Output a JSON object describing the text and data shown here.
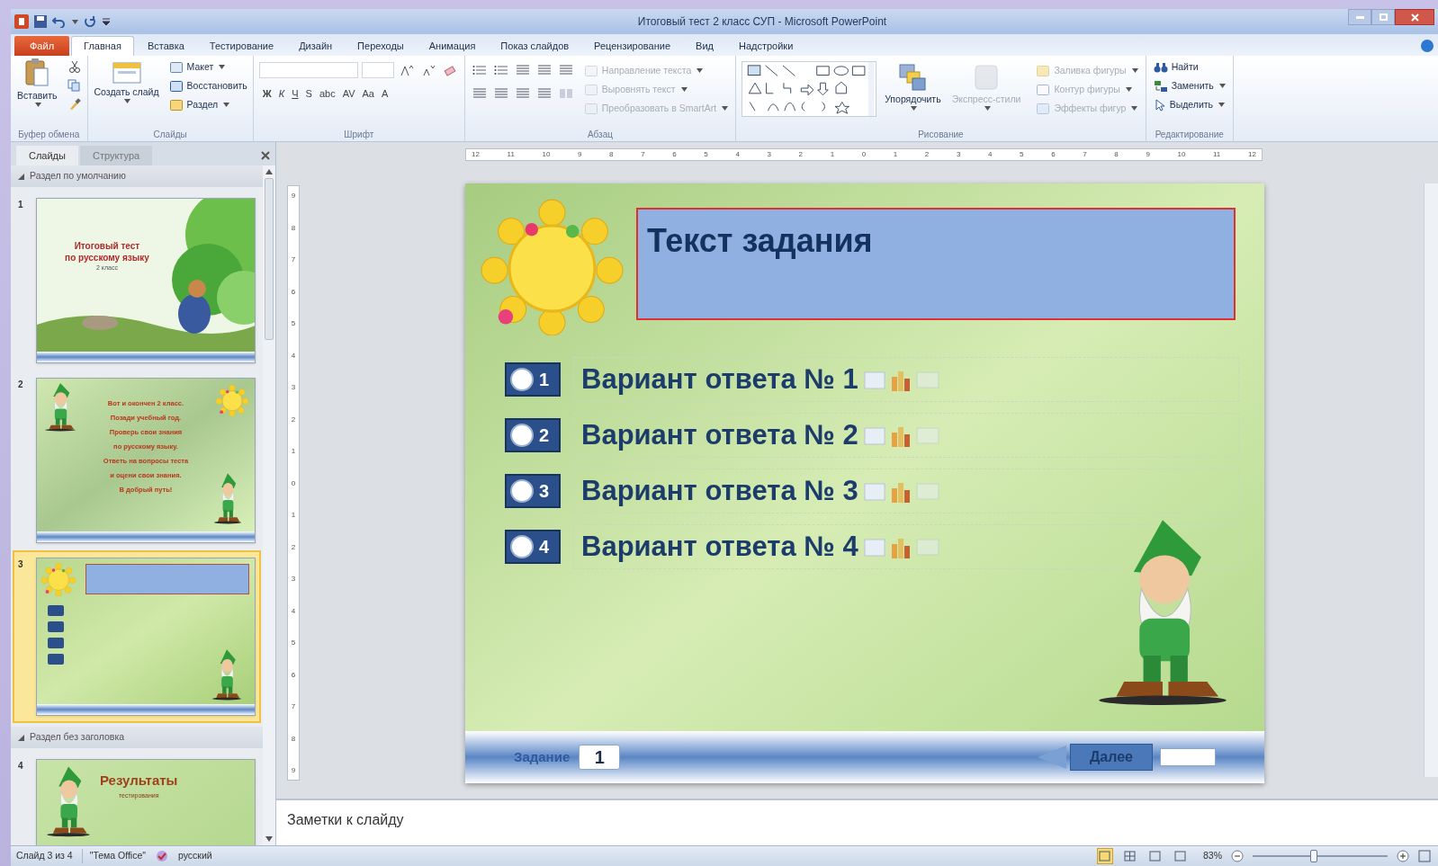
{
  "window": {
    "title": "Итоговый тест 2 класс СУП - Microsoft PowerPoint"
  },
  "file_tab": "Файл",
  "tabs": [
    {
      "label": "Главная",
      "selected": true
    },
    {
      "label": "Вставка",
      "selected": false
    },
    {
      "label": "Тестирование",
      "selected": false
    },
    {
      "label": "Дизайн",
      "selected": false
    },
    {
      "label": "Переходы",
      "selected": false
    },
    {
      "label": "Анимация",
      "selected": false
    },
    {
      "label": "Показ слайдов",
      "selected": false
    },
    {
      "label": "Рецензирование",
      "selected": false
    },
    {
      "label": "Вид",
      "selected": false
    },
    {
      "label": "Надстройки",
      "selected": false
    }
  ],
  "ribbon_groups": [
    {
      "kind": "clipboard",
      "label": "Буфер обмена",
      "items": [
        {
          "label": "Вставить",
          "disabled": false
        }
      ]
    },
    {
      "kind": "slides",
      "label": "Слайды",
      "items": [
        {
          "label": "Создать слайд",
          "disabled": false
        },
        {
          "label": "Макет",
          "disabled": false
        },
        {
          "label": "Восстановить",
          "disabled": false
        },
        {
          "label": "Раздел",
          "disabled": false
        }
      ]
    },
    {
      "kind": "font",
      "label": "Шрифт",
      "glyphs": [
        "Ж",
        "К",
        "Ч",
        "S",
        "abc",
        "AV",
        "Aa",
        "A"
      ]
    },
    {
      "kind": "paragraph",
      "label": "Абзац",
      "items": [
        {
          "label": "Направление текста",
          "disabled": true
        },
        {
          "label": "Выровнять текст",
          "disabled": true
        },
        {
          "label": "Преобразовать в SmartArt",
          "disabled": true
        }
      ]
    },
    {
      "kind": "drawing",
      "label": "Рисование",
      "items": [
        {
          "label": "Упорядочить",
          "disabled": false
        },
        {
          "label": "Экспресс-стили",
          "disabled": true
        },
        {
          "label": "Заливка фигуры",
          "disabled": true
        },
        {
          "label": "Контур фигуры",
          "disabled": true
        },
        {
          "label": "Эффекты фигур",
          "disabled": true
        }
      ]
    },
    {
      "kind": "editing",
      "label": "Редактирование",
      "items": [
        {
          "label": "Найти",
          "disabled": false
        },
        {
          "label": "Заменить",
          "disabled": false
        },
        {
          "label": "Выделить",
          "disabled": false
        }
      ]
    }
  ],
  "pane_tabs": [
    {
      "label": "Слайды",
      "selected": true
    },
    {
      "label": "Структура",
      "selected": false
    }
  ],
  "sections": [
    {
      "title": "Раздел по умолчанию",
      "expanded": true,
      "slides": [
        {
          "number": "1",
          "kind": "title",
          "selected": false,
          "texts": [
            "Итоговый тест",
            "по русскому языку",
            "2 класс"
          ]
        },
        {
          "number": "2",
          "kind": "intro",
          "selected": false,
          "texts": [
            "Вот и окончен 2 класс.",
            "Позади учебный год.",
            "Проверь свои знания",
            "по русскому языку.",
            "Ответь на вопросы теста",
            "и оцени свои знания.",
            "В добрый путь!"
          ]
        },
        {
          "number": "3",
          "kind": "quiz",
          "selected": true
        }
      ]
    },
    {
      "title": "Раздел без заголовка",
      "expanded": true,
      "slides": [
        {
          "number": "4",
          "kind": "results",
          "selected": false,
          "texts": [
            "Результаты",
            "тестирования"
          ]
        }
      ]
    }
  ],
  "ruler_h": [
    "12",
    "11",
    "10",
    "9",
    "8",
    "7",
    "6",
    "5",
    "4",
    "3",
    "2",
    "1",
    "0",
    "1",
    "2",
    "3",
    "4",
    "5",
    "6",
    "7",
    "8",
    "9",
    "10",
    "11",
    "12"
  ],
  "ruler_v": [
    "9",
    "8",
    "7",
    "6",
    "5",
    "4",
    "3",
    "2",
    "1",
    "0",
    "1",
    "2",
    "3",
    "4",
    "5",
    "6",
    "7",
    "8",
    "9"
  ],
  "slide": {
    "title": "Текст задания",
    "options": [
      {
        "number": "1",
        "text": "Вариант ответа № 1",
        "selected": false
      },
      {
        "number": "2",
        "text": "Вариант ответа № 2",
        "selected": false
      },
      {
        "number": "3",
        "text": "Вариант ответа № 3",
        "selected": false
      },
      {
        "number": "4",
        "text": "Вариант ответа № 4",
        "selected": false
      }
    ],
    "footer": {
      "label": "Задание",
      "value": "1",
      "next": "Далее"
    }
  },
  "notes": {
    "placeholder": "Заметки к слайду"
  },
  "status_bar": {
    "slide": "Слайд 3 из 4",
    "theme": "\"Тема Office\"",
    "language": "русский",
    "zoom": "83%",
    "level": 0.45,
    "views": [
      {
        "kind": "normal",
        "selected": true
      },
      {
        "kind": "sorter",
        "selected": false
      },
      {
        "kind": "reading",
        "selected": false
      },
      {
        "kind": "show",
        "selected": false
      }
    ]
  }
}
